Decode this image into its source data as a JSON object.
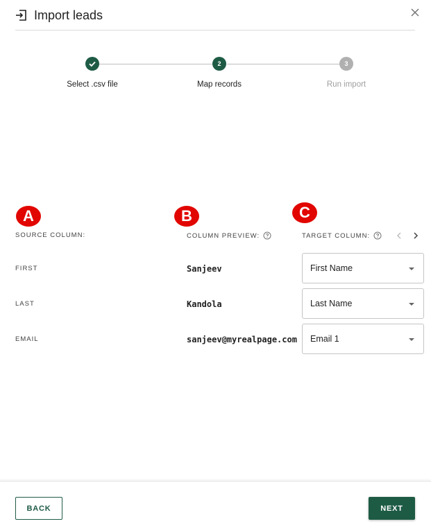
{
  "dialog": {
    "title": "Import leads",
    "header_icon": "import-icon",
    "close_icon": "close-icon"
  },
  "stepper": {
    "steps": [
      {
        "label": "Select .csv file",
        "number": "",
        "state": "completed"
      },
      {
        "label": "Map records",
        "number": "2",
        "state": "active"
      },
      {
        "label": "Run import",
        "number": "3",
        "state": "upcoming"
      }
    ]
  },
  "annotations": {
    "a": "A",
    "b": "B",
    "c": "C"
  },
  "columns": {
    "source": "SOURCE COLUMN:",
    "preview": "COLUMN PREVIEW:",
    "target": "TARGET COLUMN:"
  },
  "rows": [
    {
      "source": "FIRST",
      "preview": "Sanjeev",
      "target": "First Name"
    },
    {
      "source": "LAST",
      "preview": "Kandola",
      "target": "Last Name"
    },
    {
      "source": "EMAIL",
      "preview": "sanjeev@myrealpage.com",
      "target": "Email 1"
    }
  ],
  "footer": {
    "back_label": "BACK",
    "next_label": "NEXT"
  },
  "colors": {
    "primary": "#1e5b45",
    "badge_red": "#e10600",
    "upcoming_gray": "#b0b0b0"
  }
}
